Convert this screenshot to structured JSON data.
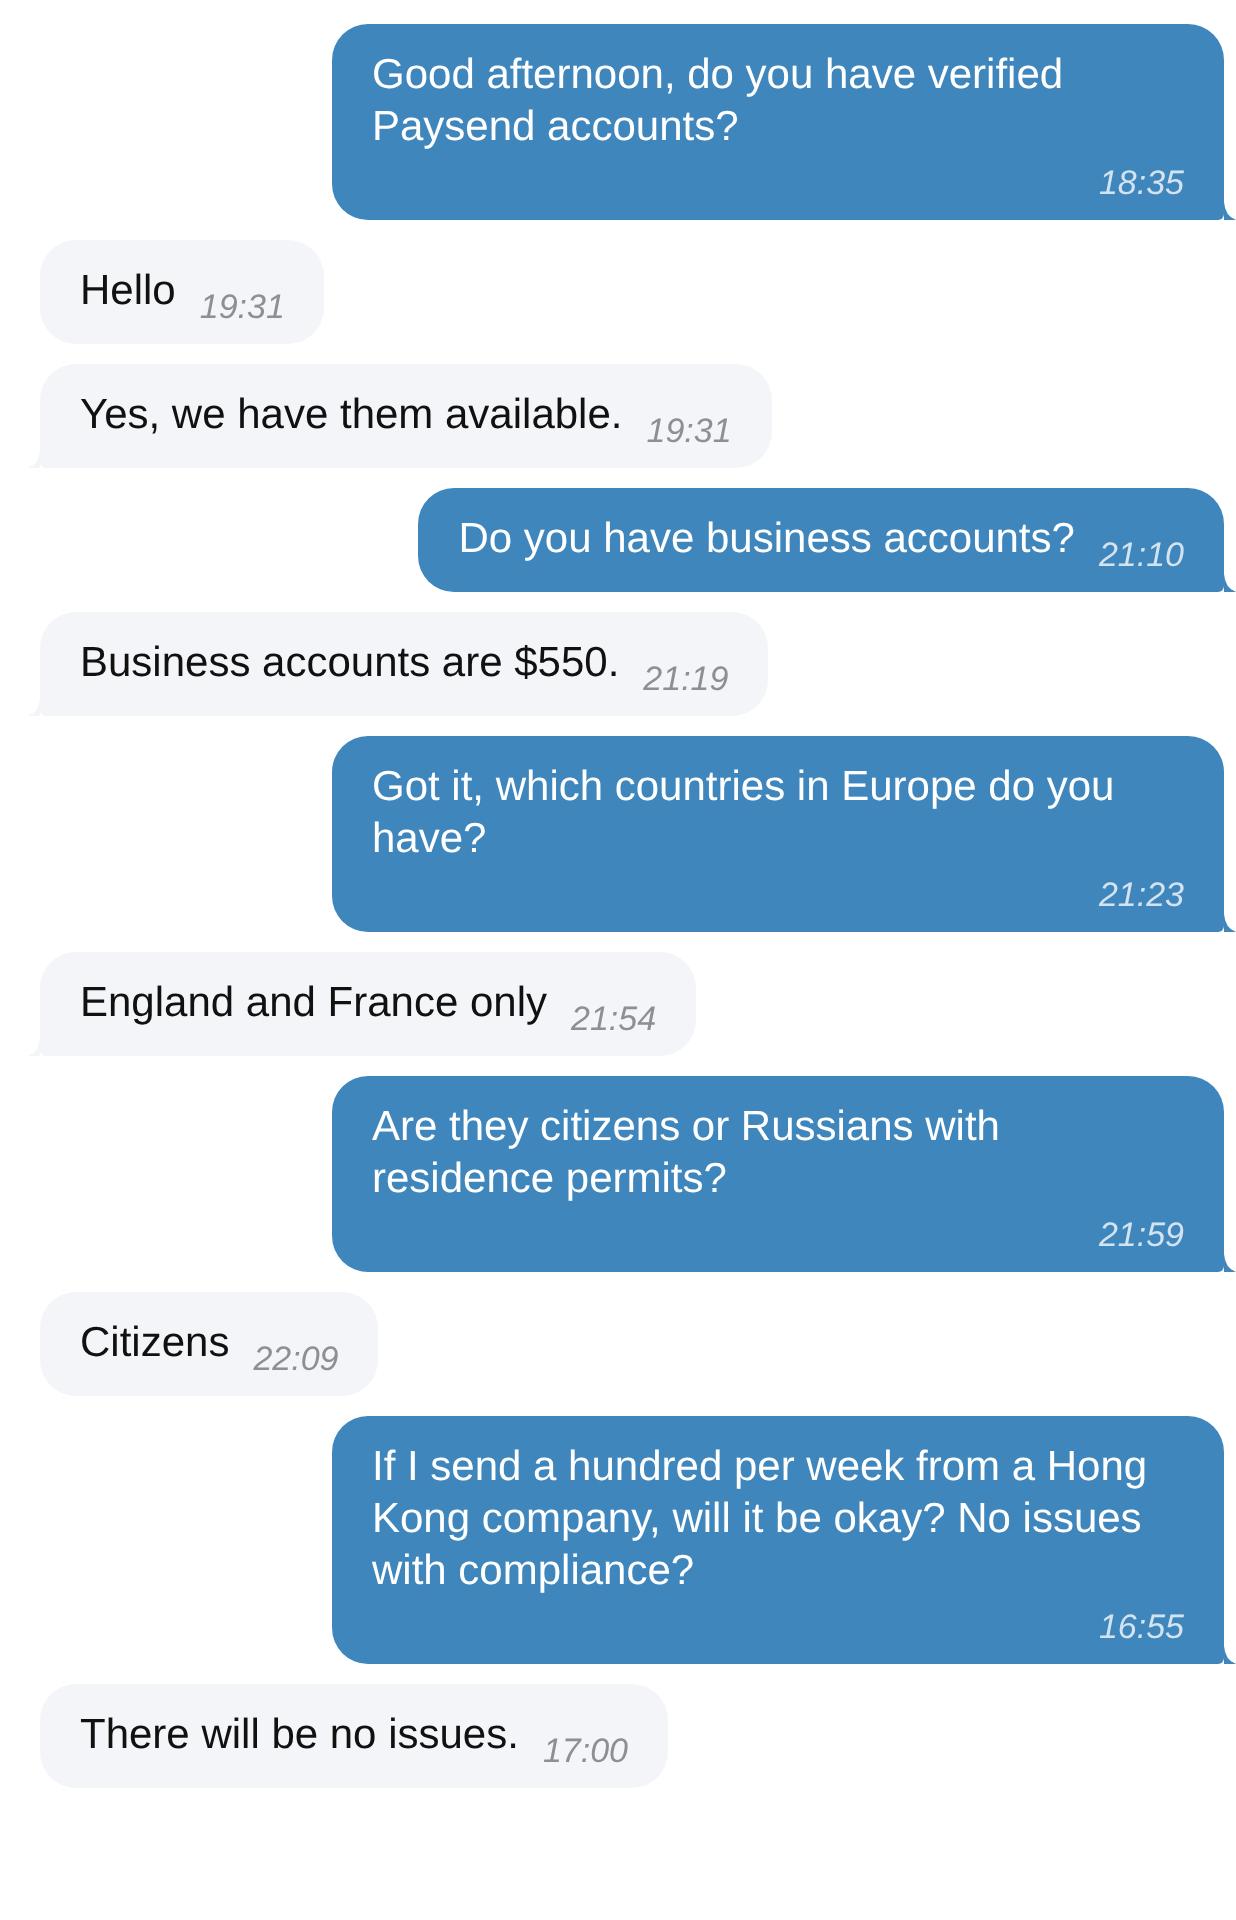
{
  "messages": [
    {
      "kind": "outgoing",
      "text": "Good afternoon, do you have verified Paysend accounts?",
      "time": "18:35",
      "tail": true
    },
    {
      "kind": "incoming",
      "text": "Hello",
      "time": "19:31",
      "tail": false
    },
    {
      "kind": "incoming",
      "text": "Yes, we have them available.",
      "time": "19:31",
      "tail": true
    },
    {
      "kind": "outgoing",
      "text": "Do you have business accounts?",
      "time": "21:10",
      "tail": true
    },
    {
      "kind": "incoming",
      "text": "Business accounts are $550.",
      "time": "21:19",
      "tail": true
    },
    {
      "kind": "outgoing",
      "text": "Got it, which countries in Europe do you have?",
      "time": "21:23",
      "tail": true
    },
    {
      "kind": "incoming",
      "text": "England and France only",
      "time": "21:54",
      "tail": true
    },
    {
      "kind": "outgoing",
      "text": "Are they citizens or Russians with residence permits?",
      "time": "21:59",
      "tail": true
    },
    {
      "kind": "incoming",
      "text": "Citizens",
      "time": "22:09",
      "tail": false
    },
    {
      "kind": "outgoing",
      "text": "If I send a hundred per week from a Hong Kong company, will it be okay? No issues with compliance?",
      "time": "16:55",
      "tail": true
    },
    {
      "kind": "incoming",
      "text": "There will be no issues.",
      "time": "17:00",
      "tail": false
    }
  ]
}
